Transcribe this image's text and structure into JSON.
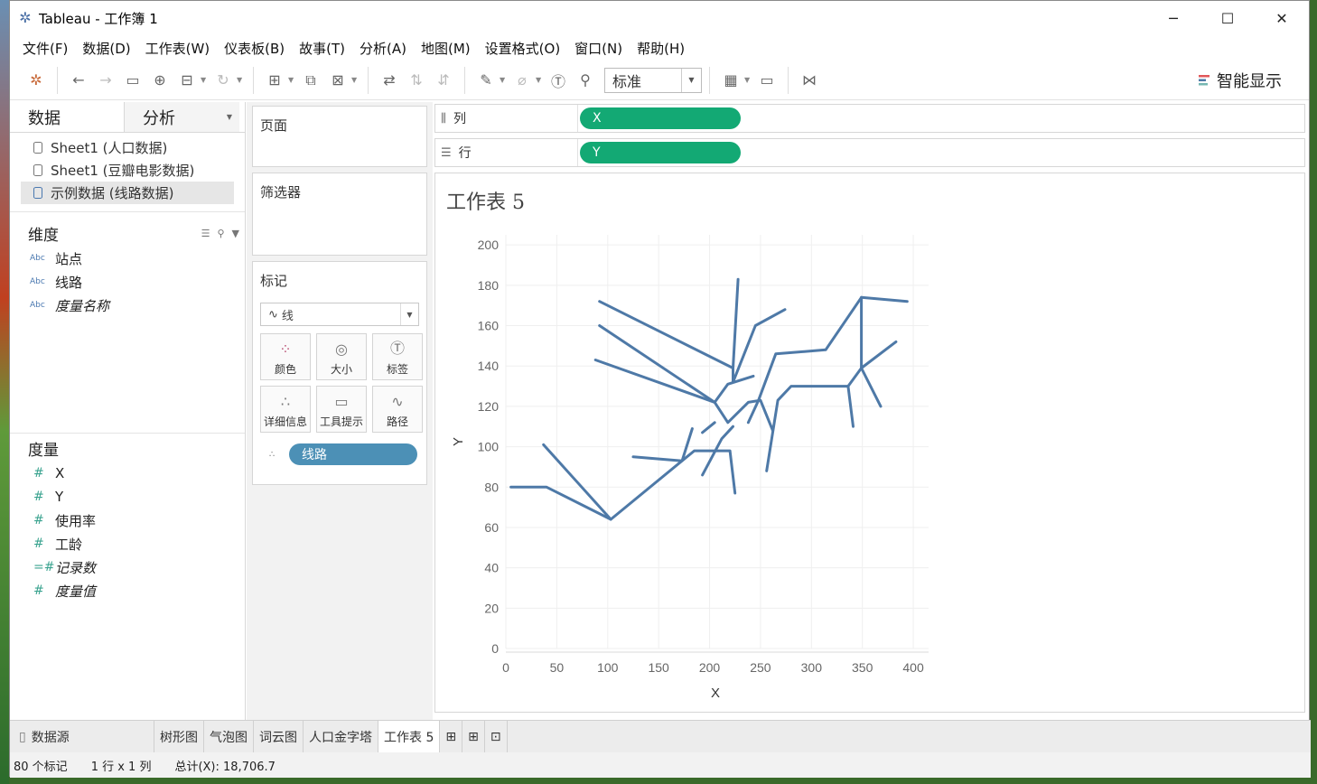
{
  "window": {
    "title": "Tableau - 工作簿 1",
    "minimize": "─",
    "maximize": "☐",
    "close": "✕"
  },
  "menu": [
    "文件(F)",
    "数据(D)",
    "工作表(W)",
    "仪表板(B)",
    "故事(T)",
    "分析(A)",
    "地图(M)",
    "设置格式(O)",
    "窗口(N)",
    "帮助(H)"
  ],
  "toolbar": {
    "fit_select": "标准",
    "smart_show": "智能显示"
  },
  "left_pane": {
    "tabs": {
      "data": "数据",
      "analysis": "分析"
    },
    "sources": [
      "Sheet1 (人口数据)",
      "Sheet1 (豆瓣电影数据)",
      "示例数据 (线路数据)"
    ],
    "dimensions_title": "维度",
    "dimensions": [
      {
        "type": "Abc",
        "name": "站点",
        "italic": false
      },
      {
        "type": "Abc",
        "name": "线路",
        "italic": false
      },
      {
        "type": "Abc",
        "name": "度量名称",
        "italic": true
      }
    ],
    "measures_title": "度量",
    "measures": [
      {
        "type": "#",
        "name": "X",
        "italic": false
      },
      {
        "type": "#",
        "name": "Y",
        "italic": false
      },
      {
        "type": "#",
        "name": "使用率",
        "italic": false
      },
      {
        "type": "#",
        "name": "工龄",
        "italic": false
      },
      {
        "type": "=#",
        "name": "记录数",
        "italic": true
      },
      {
        "type": "#",
        "name": "度量值",
        "italic": true
      }
    ]
  },
  "cards": {
    "pages": "页面",
    "filters": "筛选器",
    "marks": "标记",
    "mark_type": "线",
    "mark_buttons": [
      "颜色",
      "大小",
      "标签",
      "详细信息",
      "工具提示",
      "路径"
    ],
    "mark_pill": "线路"
  },
  "shelves": {
    "columns_label": "列",
    "columns_pill": "X",
    "rows_label": "行",
    "rows_pill": "Y"
  },
  "sheet": {
    "title": "工作表 5"
  },
  "chart_data": {
    "type": "line",
    "xlabel": "X",
    "ylabel": "Y",
    "xlim": [
      0,
      415
    ],
    "ylim": [
      0,
      205
    ],
    "xticks": [
      0,
      50,
      100,
      150,
      200,
      250,
      300,
      350,
      400
    ],
    "yticks": [
      0,
      20,
      40,
      60,
      80,
      100,
      120,
      140,
      160,
      180,
      200
    ],
    "grid": true,
    "line_color": "#4e79a7",
    "series": [
      {
        "points": [
          [
            5,
            80
          ],
          [
            40,
            80
          ],
          [
            103,
            64
          ],
          [
            185,
            98
          ],
          [
            220,
            98
          ],
          [
            225,
            77
          ]
        ]
      },
      {
        "points": [
          [
            37,
            101
          ],
          [
            103,
            64
          ]
        ]
      },
      {
        "points": [
          [
            125,
            95
          ],
          [
            173,
            93
          ],
          [
            183,
            109
          ]
        ]
      },
      {
        "points": [
          [
            92,
            172
          ],
          [
            223,
            139
          ],
          [
            228,
            183
          ]
        ]
      },
      {
        "points": [
          [
            92,
            160
          ],
          [
            205,
            122
          ],
          [
            218,
            112
          ],
          [
            238,
            122
          ],
          [
            250,
            123
          ],
          [
            262,
            108
          ]
        ]
      },
      {
        "points": [
          [
            88,
            143
          ],
          [
            205,
            122
          ],
          [
            218,
            131
          ],
          [
            243,
            135
          ]
        ]
      },
      {
        "points": [
          [
            205,
            112
          ],
          [
            193,
            107
          ]
        ]
      },
      {
        "points": [
          [
            223,
            139
          ],
          [
            223,
            132
          ],
          [
            245,
            160
          ],
          [
            274,
            168
          ]
        ]
      },
      {
        "points": [
          [
            193,
            86
          ],
          [
            212,
            104
          ],
          [
            223,
            110
          ]
        ]
      },
      {
        "points": [
          [
            256,
            88
          ],
          [
            267,
            123
          ],
          [
            280,
            130
          ],
          [
            336,
            130
          ],
          [
            341,
            110
          ]
        ]
      },
      {
        "points": [
          [
            238,
            112
          ],
          [
            248,
            123
          ],
          [
            265,
            146
          ],
          [
            314,
            148
          ],
          [
            349,
            174
          ],
          [
            394,
            172
          ]
        ]
      },
      {
        "points": [
          [
            349,
            174
          ],
          [
            349,
            139
          ],
          [
            383,
            152
          ]
        ]
      },
      {
        "points": [
          [
            349,
            139
          ],
          [
            368,
            120
          ]
        ]
      },
      {
        "points": [
          [
            336,
            130
          ],
          [
            349,
            139
          ]
        ]
      }
    ]
  },
  "bottom_tabs": [
    "数据源",
    "树形图",
    "气泡图",
    "词云图",
    "人口金字塔",
    "工作表 5"
  ],
  "status": {
    "marks": "80 个标记",
    "rows_cols": "1 行 x 1 列",
    "sum": "总计(X): 18,706.7"
  }
}
